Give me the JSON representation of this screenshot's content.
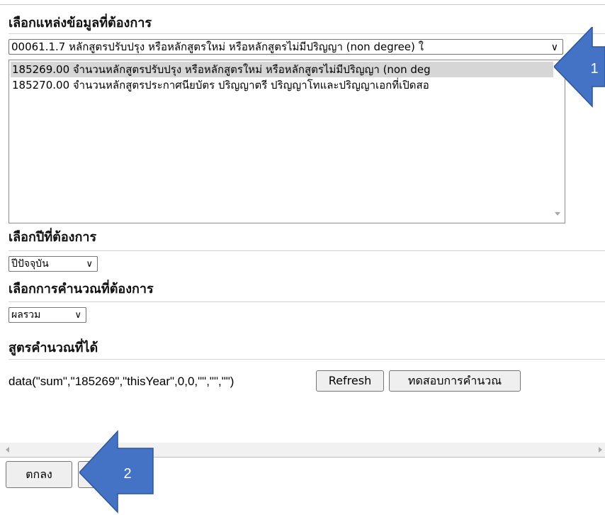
{
  "sections": {
    "source_title": "เลือกแหล่งข้อมูลที่ต้องการ",
    "year_title": "เลือกปีที่ต้องการ",
    "calc_title": "เลือกการคำนวณที่ต้องการ",
    "formula_title": "สูตรคำนวณที่ได้"
  },
  "source_select": {
    "value": "00061.1.7 หลักสูตรปรับปรุง หรือหลักสูตรใหม่ หรือหลักสูตรไม่มีปริญญา (non degree) ใ"
  },
  "source_list": [
    {
      "label": "185269.00 จำนวนหลักสูตรปรับปรุง หรือหลักสูตรใหม่ หรือหลักสูตรไม่มีปริญญา (non deg",
      "selected": true
    },
    {
      "label": "185270.00 จำนวนหลักสูตรประกาศนียบัตร ปริญญาตรี ปริญญาโทและปริญญาเอกที่เปิดสอ",
      "selected": false
    }
  ],
  "year_select": {
    "value": "ปีปัจจุบัน"
  },
  "calc_select": {
    "value": "ผลรวม"
  },
  "formula": {
    "text": "data(\"sum\",\"185269\",\"thisYear\",0,0,\"\",\"\",\"\")"
  },
  "buttons": {
    "refresh": "Refresh",
    "test": "ทดสอบการคำนวณ",
    "ok": "ตกลง",
    "second": ""
  },
  "callouts": {
    "one": "1",
    "two": "2",
    "color": "#4472C4"
  },
  "icons": {
    "dropdown": "chevron-down-icon"
  }
}
